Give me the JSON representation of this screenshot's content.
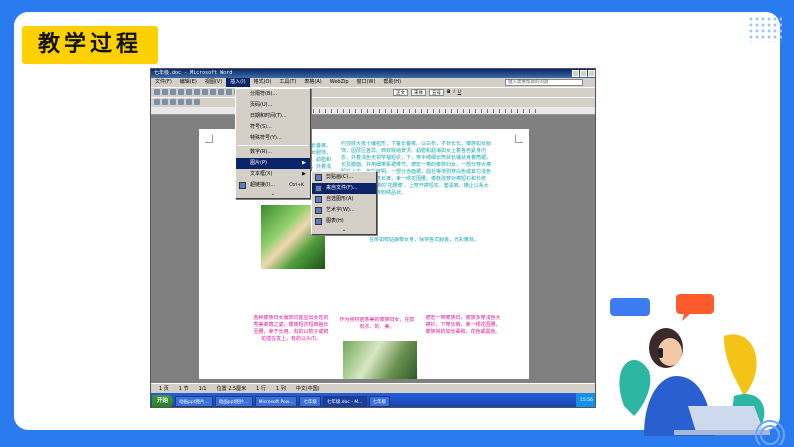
{
  "slide": {
    "title": "教学过程"
  },
  "window": {
    "title": "七年级.doc - Microsoft Word",
    "help_placeholder": "键入需要帮助的问题"
  },
  "menubar": {
    "items": [
      "文件(F)",
      "编辑(E)",
      "视图(V)",
      "插入(I)",
      "格式(O)",
      "工具(T)",
      "表格(A)",
      "WebZip",
      "窗口(W)",
      "帮助(H)"
    ]
  },
  "toolbar": {
    "style": "正文",
    "font": "宋体",
    "size": "五号"
  },
  "insert_menu": {
    "items": [
      {
        "label": "分隔符(B)...",
        "arrow": false
      },
      {
        "label": "页码(U)...",
        "arrow": false
      },
      {
        "label": "日期和时间(T)...",
        "arrow": false
      },
      {
        "label": "符号(S)...",
        "arrow": false
      },
      {
        "label": "特殊符号(Y)...",
        "arrow": false
      },
      {
        "label": "数字(R)...",
        "arrow": false
      },
      {
        "label": "图片(P)",
        "arrow": true,
        "selected": true
      },
      {
        "label": "文本框(X)",
        "arrow": true
      },
      {
        "label": "超链接(I)...",
        "shortcut": "Ctrl+K"
      }
    ]
  },
  "picture_submenu": {
    "items": [
      {
        "label": "剪贴画(C)...",
        "selected": false
      },
      {
        "label": "来自文件(F)...",
        "selected": true
      },
      {
        "label": "自选图形(A)",
        "selected": false
      },
      {
        "label": "艺术字(W)...",
        "selected": false
      },
      {
        "label": "图表(H)",
        "selected": false
      }
    ]
  },
  "document": {
    "para1": "约顶底大抵十编拓形，下垂长叠裤。以白布，不背长长。傣族如女服饰，因层区各异。西双版纳景洪、勐腊和勐海如女上着各色紧身内衣，外着浅色无领窄袖短衣；下，穿半缚细长筒状长桶状身着筒裙，长及脚面。并用细带系裙棒节。德宏一带的傣族妇女，一部分穿大襟短衫上衣，色彩鲜明。一部分当面裙，圆社等地则穿白色或其它浅色的大襟短衫，下着长裤，束一绣花围腰。傣族改穿对襟短衫和长统裙；胸至元以一带的'花腰傣'，上穿开襟短衣，套黑裤。横止以系大红刺绣锦胶的傣族刺绣品状。",
    "para1b": "在亲如鲜姑娘傣女身，保将各式服装，光彩耀目。",
    "col1": "各种傣族妇女服饰均能显出女性的秀美柔丽之姿，傣族短衣短裤袖长至腰，束于长用。有的以梳子或鲜花插在发上，有的以头巾。",
    "col2": "作为身材苗条美的傣族妇女，在款有衣、的、美。",
    "col3": "德宏一带傣族妇，傣族多穿浅色大襟衫，下穿长裤，束一绣花围腰，傣族常的如长辈和，花色或黑色。"
  },
  "statusbar": {
    "page": "1 页",
    "section": "1 节",
    "pages": "1/1",
    "position": "位置 2.5厘米",
    "line": "1 行",
    "col": "1 列",
    "lang": "中文(中国)"
  },
  "taskbar": {
    "start": "开始",
    "tasks": [
      "动画ppt图片...",
      "动画ppt图片...",
      "Microsoft Pow...",
      "七年级",
      "七年级.doc - M...",
      "七年级"
    ],
    "clock": "15:56"
  },
  "colors": {
    "frame": "#2b7bf0",
    "title_bg": "#ffd000",
    "text_cyan": "#19a7b3",
    "text_pink": "#e0169a"
  }
}
